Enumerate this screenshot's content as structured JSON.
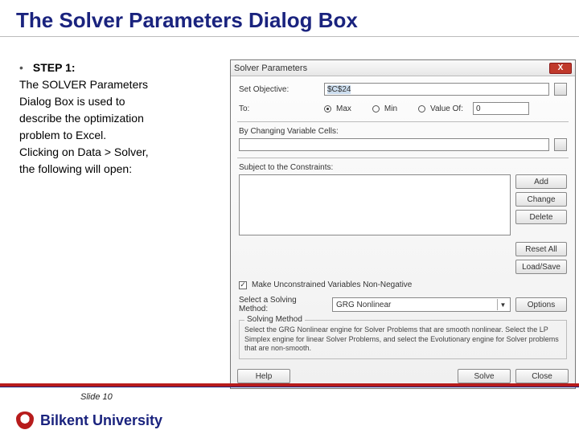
{
  "slide": {
    "title": "The Solver Parameters Dialog Box",
    "step_label": "STEP 1:",
    "body_l1": "The SOLVER Parameters",
    "body_l2": "Dialog Box is used to",
    "body_l3": "describe the optimization",
    "body_l4": "problem to Excel.",
    "body_l5": "Clicking on Data > Solver,",
    "body_l6": "the following will open:",
    "slide_number": "Slide 10",
    "university": "Bilkent University"
  },
  "dialog": {
    "title": "Solver Parameters",
    "close": "X",
    "set_objective_label": "Set Objective:",
    "set_objective_value": "$C$24",
    "to_label": "To:",
    "opt_max": "Max",
    "opt_min": "Min",
    "opt_valueof": "Value Of:",
    "valueof_value": "0",
    "changing_label": "By Changing Variable Cells:",
    "constraints_label": "Subject to the Constraints:",
    "btn_add": "Add",
    "btn_change": "Change",
    "btn_delete": "Delete",
    "btn_reset": "Reset All",
    "btn_loadsave": "Load/Save",
    "chk_nonneg": "Make Unconstrained Variables Non-Negative",
    "method_label": "Select a Solving Method:",
    "method_value": "GRG Nonlinear",
    "btn_options": "Options",
    "group_label": "Solving Method",
    "group_text": "Select the GRG Nonlinear engine for Solver Problems that are smooth nonlinear. Select the LP Simplex engine for linear Solver Problems, and select the Evolutionary engine for Solver problems that are non-smooth.",
    "btn_help": "Help",
    "btn_solve": "Solve",
    "btn_close": "Close"
  }
}
